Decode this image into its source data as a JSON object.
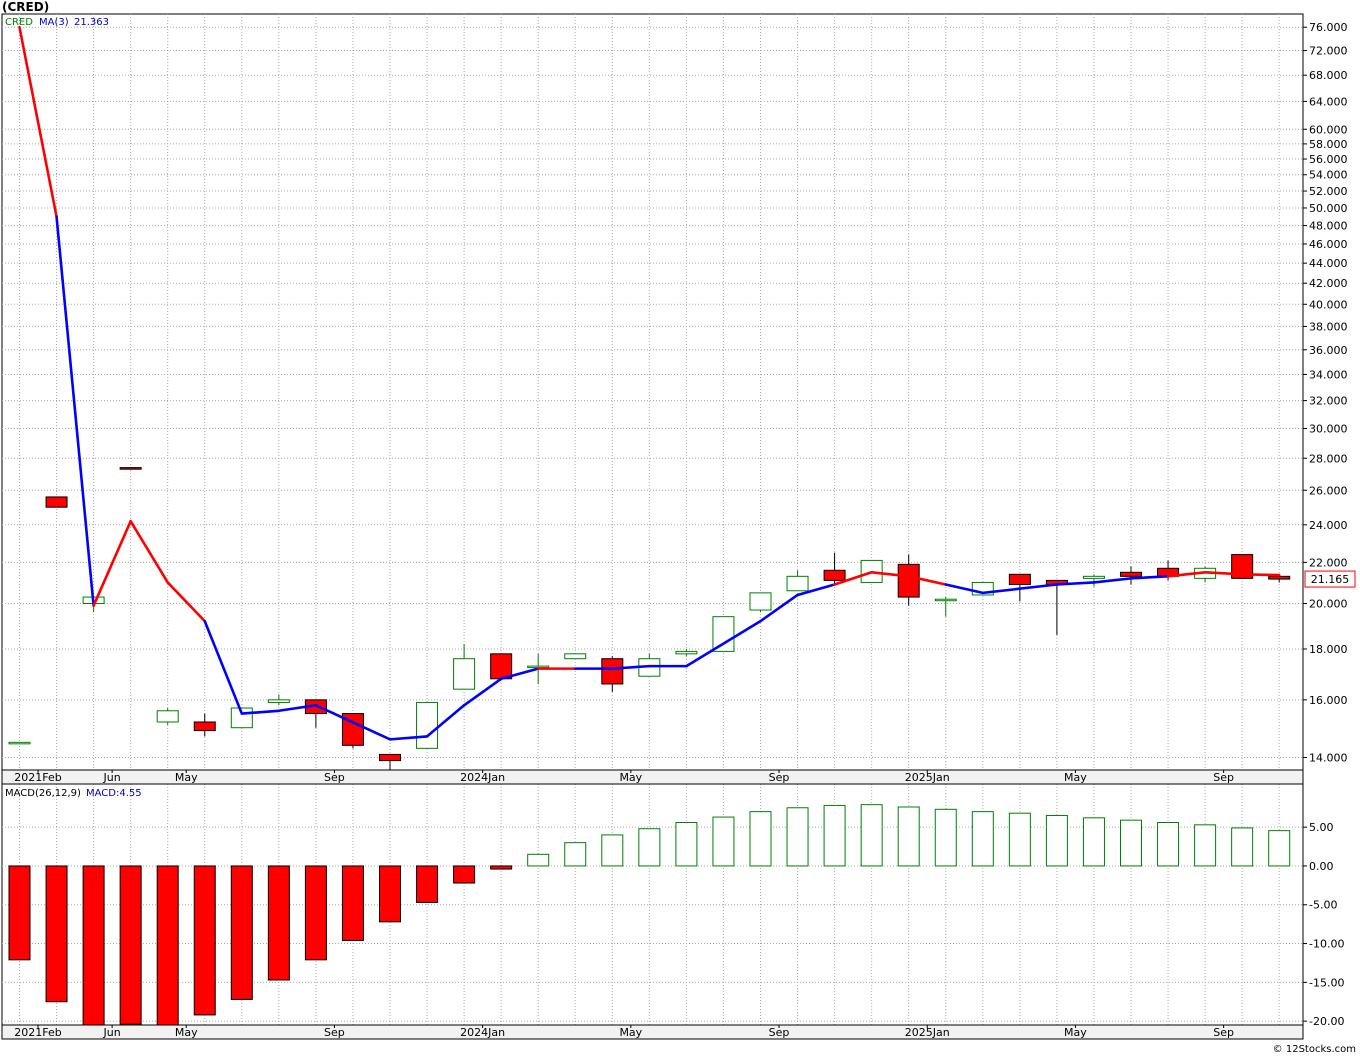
{
  "page": {
    "title": "(CRED)",
    "watermark": "© 12Stocks.com"
  },
  "legend": {
    "price": {
      "symbol": "CRED",
      "ma_label": "MA(3)",
      "ma_value": "21.363",
      "symbol_color": "#008000",
      "ma_color": "#0000cc"
    },
    "macd": {
      "label": "MACD(26,12,9)",
      "value_label": "MACD:4.55"
    }
  },
  "colors": {
    "up": "#008000",
    "down": "#ff0000",
    "ma_up": "#0000ff",
    "ma_down": "#ff0000",
    "last_price_border": "#ff0000"
  },
  "x_axis": {
    "labels": [
      "2021Feb",
      "Jun",
      "May",
      "Sep",
      "2024Jan",
      "May",
      "Sep",
      "2025Jan",
      "May",
      "Sep"
    ],
    "label_after_index": [
      0,
      2,
      4,
      8,
      12,
      16,
      20,
      24,
      28,
      32
    ]
  },
  "chart_data": [
    {
      "type": "candlestick",
      "title": "",
      "y_scale": "log",
      "ylim": [
        13.6,
        78.0
      ],
      "y_ticks": [
        14,
        16,
        18,
        20,
        22,
        24,
        26,
        28,
        30,
        32,
        34,
        36,
        38,
        40,
        42,
        44,
        46,
        48,
        50,
        52,
        54,
        56,
        58,
        60,
        64,
        68,
        72,
        76
      ],
      "last_price": "21.165",
      "candles": [
        {
          "o": 14.5,
          "h": 14.5,
          "l": 14.5,
          "c": 14.5
        },
        {
          "o": 25.6,
          "h": 25.6,
          "l": 25.0,
          "c": 25.0
        },
        {
          "o": 20.0,
          "h": 20.3,
          "l": 19.6,
          "c": 20.3
        },
        {
          "o": 27.4,
          "h": 27.4,
          "l": 27.3,
          "c": 27.3
        },
        {
          "o": 15.2,
          "h": 15.7,
          "l": 15.1,
          "c": 15.6
        },
        {
          "o": 15.2,
          "h": 15.5,
          "l": 14.7,
          "c": 14.9
        },
        {
          "o": 15.0,
          "h": 15.7,
          "l": 15.0,
          "c": 15.7
        },
        {
          "o": 15.9,
          "h": 16.2,
          "l": 15.8,
          "c": 16.0
        },
        {
          "o": 16.0,
          "h": 16.0,
          "l": 15.0,
          "c": 15.5
        },
        {
          "o": 15.5,
          "h": 15.5,
          "l": 14.3,
          "c": 14.4
        },
        {
          "o": 14.1,
          "h": 14.1,
          "l": 13.6,
          "c": 13.9
        },
        {
          "o": 14.3,
          "h": 15.9,
          "l": 14.3,
          "c": 15.9
        },
        {
          "o": 16.4,
          "h": 18.2,
          "l": 16.4,
          "c": 17.6
        },
        {
          "o": 17.8,
          "h": 17.8,
          "l": 16.8,
          "c": 16.8
        },
        {
          "o": 17.3,
          "h": 17.8,
          "l": 16.6,
          "c": 17.3
        },
        {
          "o": 17.6,
          "h": 17.8,
          "l": 17.6,
          "c": 17.8
        },
        {
          "o": 17.6,
          "h": 17.7,
          "l": 16.3,
          "c": 16.6
        },
        {
          "o": 16.9,
          "h": 17.8,
          "l": 16.9,
          "c": 17.6
        },
        {
          "o": 17.8,
          "h": 18.0,
          "l": 17.7,
          "c": 17.9
        },
        {
          "o": 17.9,
          "h": 19.4,
          "l": 17.9,
          "c": 19.4
        },
        {
          "o": 19.7,
          "h": 20.5,
          "l": 19.6,
          "c": 20.5
        },
        {
          "o": 20.6,
          "h": 21.6,
          "l": 20.6,
          "c": 21.3
        },
        {
          "o": 21.6,
          "h": 22.5,
          "l": 20.9,
          "c": 21.1
        },
        {
          "o": 21.0,
          "h": 22.1,
          "l": 21.0,
          "c": 22.1
        },
        {
          "o": 21.9,
          "h": 22.4,
          "l": 19.9,
          "c": 20.3
        },
        {
          "o": 20.2,
          "h": 20.3,
          "l": 19.4,
          "c": 20.2
        },
        {
          "o": 20.4,
          "h": 21.0,
          "l": 20.4,
          "c": 21.0
        },
        {
          "o": 21.4,
          "h": 21.4,
          "l": 20.1,
          "c": 20.9
        },
        {
          "o": 21.1,
          "h": 21.1,
          "l": 18.6,
          "c": 20.9
        },
        {
          "o": 21.2,
          "h": 21.4,
          "l": 20.8,
          "c": 21.3
        },
        {
          "o": 21.5,
          "h": 21.8,
          "l": 20.9,
          "c": 21.3
        },
        {
          "o": 21.7,
          "h": 22.1,
          "l": 21.1,
          "c": 21.3
        },
        {
          "o": 21.2,
          "h": 21.8,
          "l": 21.0,
          "c": 21.7
        },
        {
          "o": 22.4,
          "h": 22.4,
          "l": 21.2,
          "c": 21.2
        },
        {
          "o": 21.3,
          "h": 21.3,
          "l": 21.0,
          "c": 21.165
        }
      ],
      "ma3": [
        76.0,
        49.0,
        19.9,
        24.2,
        21.0,
        19.2,
        15.5,
        15.6,
        15.8,
        null,
        14.6,
        14.7,
        15.8,
        16.8,
        17.2,
        17.2,
        17.2,
        17.3,
        17.3,
        null,
        19.2,
        20.4,
        20.9,
        21.5,
        21.3,
        20.9,
        20.5,
        null,
        20.9,
        21.0,
        21.2,
        21.3,
        21.5,
        21.4,
        21.363
      ],
      "ma3_direction": [
        "down",
        "down",
        "up",
        "down",
        "down",
        "down",
        "up",
        "up",
        "up",
        "down",
        "up",
        "up",
        "up",
        "up",
        "up",
        "down",
        "up",
        "up",
        "up",
        "up",
        "up",
        "up",
        "up",
        "down",
        "down",
        "down",
        "up",
        "up",
        "up",
        "up",
        "up",
        "up",
        "down",
        "down",
        "down"
      ]
    },
    {
      "type": "bar",
      "title": "",
      "ylim": [
        -20.5,
        8.5
      ],
      "y_ticks": [
        -20,
        -15,
        -10,
        -5,
        0,
        5
      ],
      "y_tick_labels": [
        "-20.00",
        "-15.00",
        "-10.00",
        "-5.00",
        "0.00",
        "5.00"
      ],
      "values": [
        -12.1,
        -17.5,
        -20.5,
        -20.4,
        -20.5,
        -19.2,
        -17.2,
        -14.7,
        -12.1,
        -9.6,
        -7.2,
        -4.7,
        -2.2,
        -0.4,
        1.5,
        3.0,
        4.0,
        4.8,
        5.6,
        6.3,
        7.0,
        7.5,
        7.8,
        7.9,
        7.6,
        7.3,
        7.0,
        6.8,
        6.5,
        6.2,
        5.9,
        5.6,
        5.3,
        4.9,
        4.55
      ]
    }
  ]
}
